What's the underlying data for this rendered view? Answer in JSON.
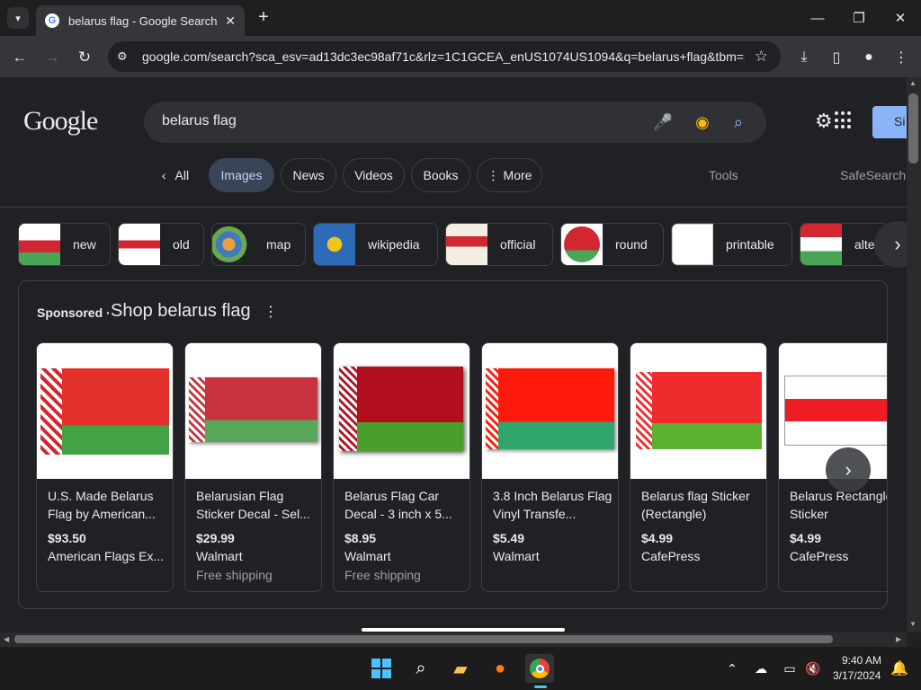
{
  "browser": {
    "tab_title": "belarus flag - Google Search",
    "url": "google.com/search?sca_esv=ad13dc3ec98af71c&rlz=1C1GCEA_enUS1074US1094&q=belarus+flag&tbm=i..."
  },
  "google": {
    "logo": "Google",
    "query": "belarus flag",
    "signin_label": "Si"
  },
  "filters": {
    "all": "All",
    "images": "Images",
    "news": "News",
    "videos": "Videos",
    "books": "Books",
    "more": "More",
    "tools": "Tools",
    "safesearch": "SafeSearch"
  },
  "chips": [
    {
      "label": "new"
    },
    {
      "label": "old"
    },
    {
      "label": "map"
    },
    {
      "label": "wikipedia"
    },
    {
      "label": "official"
    },
    {
      "label": "round"
    },
    {
      "label": "printable"
    },
    {
      "label": "alte"
    }
  ],
  "shopping": {
    "sponsored": "Sponsored ·",
    "title": "Shop belarus flag",
    "products": [
      {
        "title": "U.S. Made Belarus Flag by American...",
        "price": "$93.50",
        "store": "American Flags Ex...",
        "shipping": ""
      },
      {
        "title": "Belarusian Flag Sticker Decal - Sel...",
        "price": "$29.99",
        "store": "Walmart",
        "shipping": "Free shipping"
      },
      {
        "title": "Belarus Flag Car Decal - 3 inch x 5...",
        "price": "$8.95",
        "store": "Walmart",
        "shipping": "Free shipping"
      },
      {
        "title": "3.8 Inch Belarus Flag Vinyl Transfe...",
        "price": "$5.49",
        "store": "Walmart",
        "shipping": ""
      },
      {
        "title": "Belarus flag Sticker (Rectangle)",
        "price": "$4.99",
        "store": "CafePress",
        "shipping": ""
      },
      {
        "title": "Belarus Rectangle Sticker",
        "price": "$4.99",
        "store": "CafePress",
        "shipping": ""
      }
    ]
  },
  "taskbar": {
    "time": "9:40 AM",
    "date": "3/17/2024"
  },
  "colors": {
    "flag_red": "#d22730",
    "flag_green": "#4aa657",
    "accent": "#8ab4f8"
  }
}
